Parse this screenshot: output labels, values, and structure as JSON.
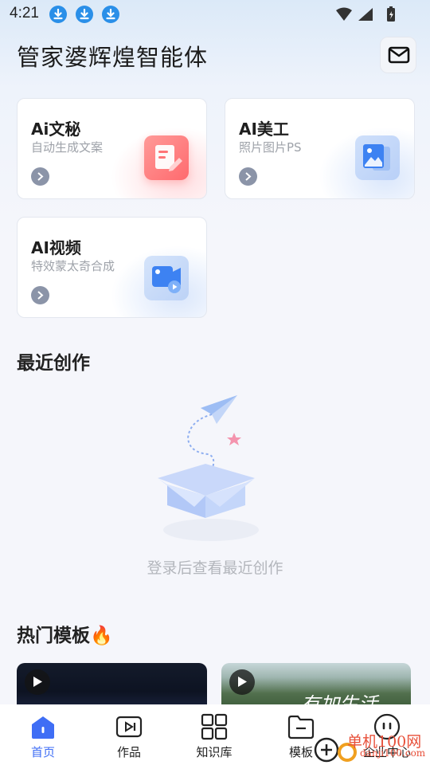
{
  "status_bar": {
    "time": "4:21"
  },
  "header": {
    "title": "管家婆辉煌智能体"
  },
  "cards": [
    {
      "title": "Ai文秘",
      "subtitle": "自动生成文案",
      "icon": "document-edit-icon"
    },
    {
      "title": "AI美工",
      "subtitle": "照片图片PS",
      "icon": "image-icon"
    },
    {
      "title": "AI视频",
      "subtitle": "特效蒙太奇合成",
      "icon": "video-camera-icon"
    }
  ],
  "recent": {
    "title": "最近创作",
    "empty_text": "登录后查看最近创作"
  },
  "hot": {
    "title": "热门模板",
    "emoji": "🔥",
    "thumb2_text": "有加生活"
  },
  "nav": {
    "items": [
      {
        "label": "首页",
        "icon": "home-icon",
        "active": true
      },
      {
        "label": "作品",
        "icon": "works-icon"
      },
      {
        "label": "知识库",
        "icon": "knowledge-grid-icon"
      },
      {
        "label": "模板",
        "icon": "template-folder-icon"
      },
      {
        "label": "企业中心",
        "icon": "robot-icon"
      }
    ]
  },
  "watermark": {
    "line1": "单机100网",
    "line2": "danji100.com"
  },
  "colors": {
    "accent": "#3f6ef5",
    "background": "#f5f6fb",
    "card": "#ffffff"
  }
}
